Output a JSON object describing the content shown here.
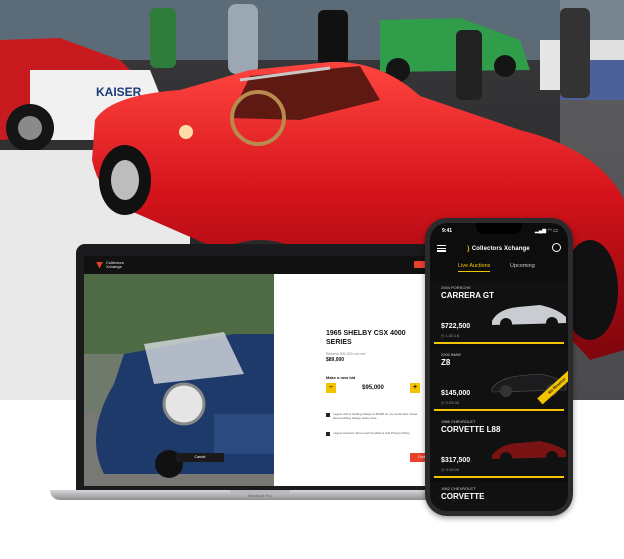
{
  "laptop": {
    "brand_lines": "Collectors Xchange",
    "listing_title": "1965 SHELBY CSX 4000 SERIES",
    "reserve_label": "Reserve $92,000 not met",
    "current_price": "$89,000",
    "bid_label": "Make a new bid",
    "decrement_label": "–",
    "increment_label": "+",
    "bid_value": "$95,000",
    "checkbox_1": "I agree with a holding charge of $1000 on my credit card. Never about holding charge policy here.",
    "checkbox_2": "I agree Auctions Terms and Conditions and Privacy Policy.",
    "cancel_label": "Cancel",
    "confirm_label": "Continue",
    "device_label": "MacBook Pro"
  },
  "phone": {
    "time": "9:41",
    "status": "▂▄▆ ◠ ▭",
    "brand": "Collectors Xchange",
    "tabs": [
      "Live Auctions",
      "Upcoming"
    ],
    "listings": [
      {
        "year": "2004 PORSCHE",
        "model": "CARRERA GT",
        "price": "$722,500",
        "time": "◷ 1:32:18"
      },
      {
        "year": "2000 BMW",
        "model": "Z8",
        "price": "$145,000",
        "time": "◷ 2:23:30",
        "badge": "No Reserve"
      },
      {
        "year": "1966 CHEVROLET",
        "model": "CORVETTE L88",
        "price": "$317,500",
        "time": "◷ 3:10:00"
      },
      {
        "year": "1962 CHEVROLET",
        "model": "CORVETTE",
        "price": "",
        "time": ""
      }
    ]
  },
  "colors": {
    "accent": "#f5c400",
    "brand_red": "#e8412c",
    "hero_car": "#d3121a"
  }
}
